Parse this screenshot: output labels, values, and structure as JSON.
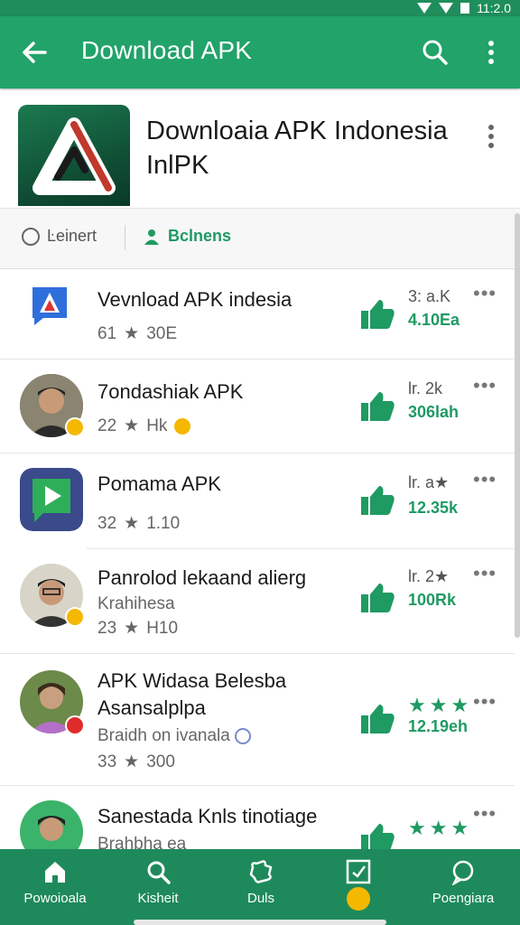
{
  "status_bar": {
    "time": "11:2.0"
  },
  "app_bar": {
    "title": "Download APK"
  },
  "hero": {
    "name_line1": "Downloaia APK Indonesia",
    "name_line2": "InlPK"
  },
  "filters": {
    "option1": "Ŀeinert",
    "option2": "Bclnens"
  },
  "rows": [
    {
      "title": "Vevnload APK indesia",
      "meta_num": "61",
      "meta_val": "30E",
      "c1": "3: a.K",
      "c2": "4.10Ea"
    },
    {
      "title": "7ondashiak APK",
      "meta_num": "22",
      "meta_val": "Hk",
      "c1": "lr. 2k",
      "c2": "306lah"
    },
    {
      "title": "Pomama APK",
      "meta_num": "32",
      "meta_val": "1.10",
      "c1": "lr. a★",
      "c2": "12.35k"
    },
    {
      "title": "Panrolod lekaand alierg",
      "sub": "Krahihesa",
      "meta_num": "23",
      "meta_val": "H10",
      "c1": "lr. 2★",
      "c2": "100Rk"
    },
    {
      "title": "APK  Widasa Belesba",
      "title2": "Asansalplpa",
      "sub": "Braidh on ivanala",
      "meta_num": "33",
      "meta_val": "300",
      "c2": "12.19eh"
    },
    {
      "title": "Sanestada Knls tinotiage",
      "sub": "Brahbha ea"
    }
  ],
  "bottom_nav": [
    {
      "label": "Powoioala"
    },
    {
      "label": "Kisheit"
    },
    {
      "label": "Duls"
    },
    {
      "label": ""
    },
    {
      "label": "Poengiara"
    }
  ],
  "colors": {
    "primary": "#21a36a",
    "nav": "#1e8a5b",
    "accent_green": "#1f9a63"
  }
}
